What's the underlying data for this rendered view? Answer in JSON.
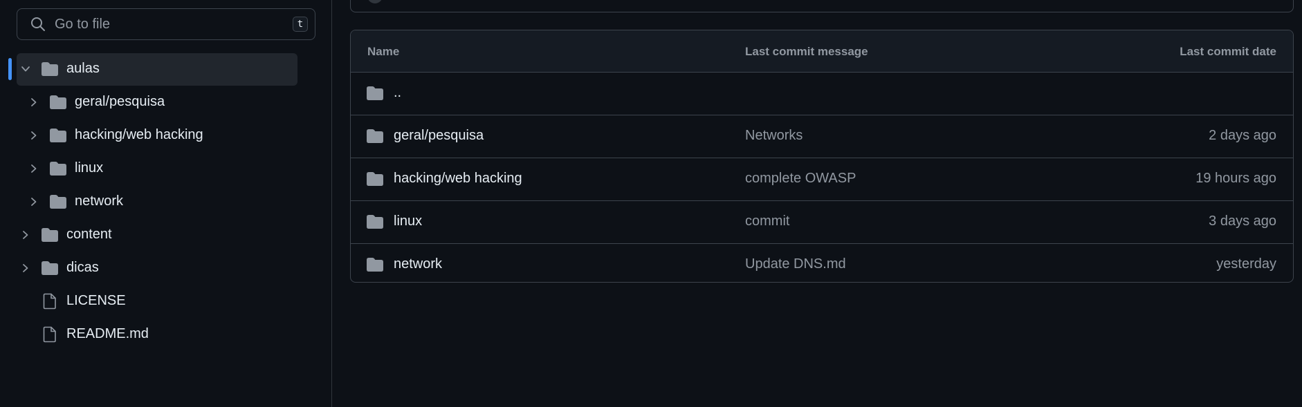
{
  "colors": {
    "background": "#0d1117",
    "border": "#3d444d",
    "text_primary": "#e6edf3",
    "text_muted": "#9198a1",
    "folder_icon": "#9198a1",
    "selected_bg": "#21262d",
    "accent": "#4493f8"
  },
  "search": {
    "placeholder": "Go to file",
    "shortcut_key": "t",
    "icon": "search-icon"
  },
  "tree": {
    "items": [
      {
        "label": "aulas",
        "type": "folder",
        "expanded": true,
        "selected": true,
        "level": 0
      },
      {
        "label": "geral/pesquisa",
        "type": "folder",
        "expanded": false,
        "selected": false,
        "level": 1
      },
      {
        "label": "hacking/web hacking",
        "type": "folder",
        "expanded": false,
        "selected": false,
        "level": 1
      },
      {
        "label": "linux",
        "type": "folder",
        "expanded": false,
        "selected": false,
        "level": 1
      },
      {
        "label": "network",
        "type": "folder",
        "expanded": false,
        "selected": false,
        "level": 1
      },
      {
        "label": "content",
        "type": "folder",
        "expanded": false,
        "selected": false,
        "level": 0
      },
      {
        "label": "dicas",
        "type": "folder",
        "expanded": false,
        "selected": false,
        "level": 0
      },
      {
        "label": "LICENSE",
        "type": "file",
        "level": 0
      },
      {
        "label": "README.md",
        "type": "file",
        "level": 0
      }
    ]
  },
  "table": {
    "headers": {
      "name": "Name",
      "message": "Last commit message",
      "date": "Last commit date"
    },
    "rows": [
      {
        "name": "..",
        "message": "",
        "date": ""
      },
      {
        "name": "geral/pesquisa",
        "message": "Networks",
        "date": "2 days ago"
      },
      {
        "name": "hacking/web hacking",
        "message": "complete OWASP",
        "date": "19 hours ago"
      },
      {
        "name": "linux",
        "message": "commit",
        "date": "3 days ago"
      },
      {
        "name": "network",
        "message": "Update DNS.md",
        "date": "yesterday"
      }
    ]
  }
}
